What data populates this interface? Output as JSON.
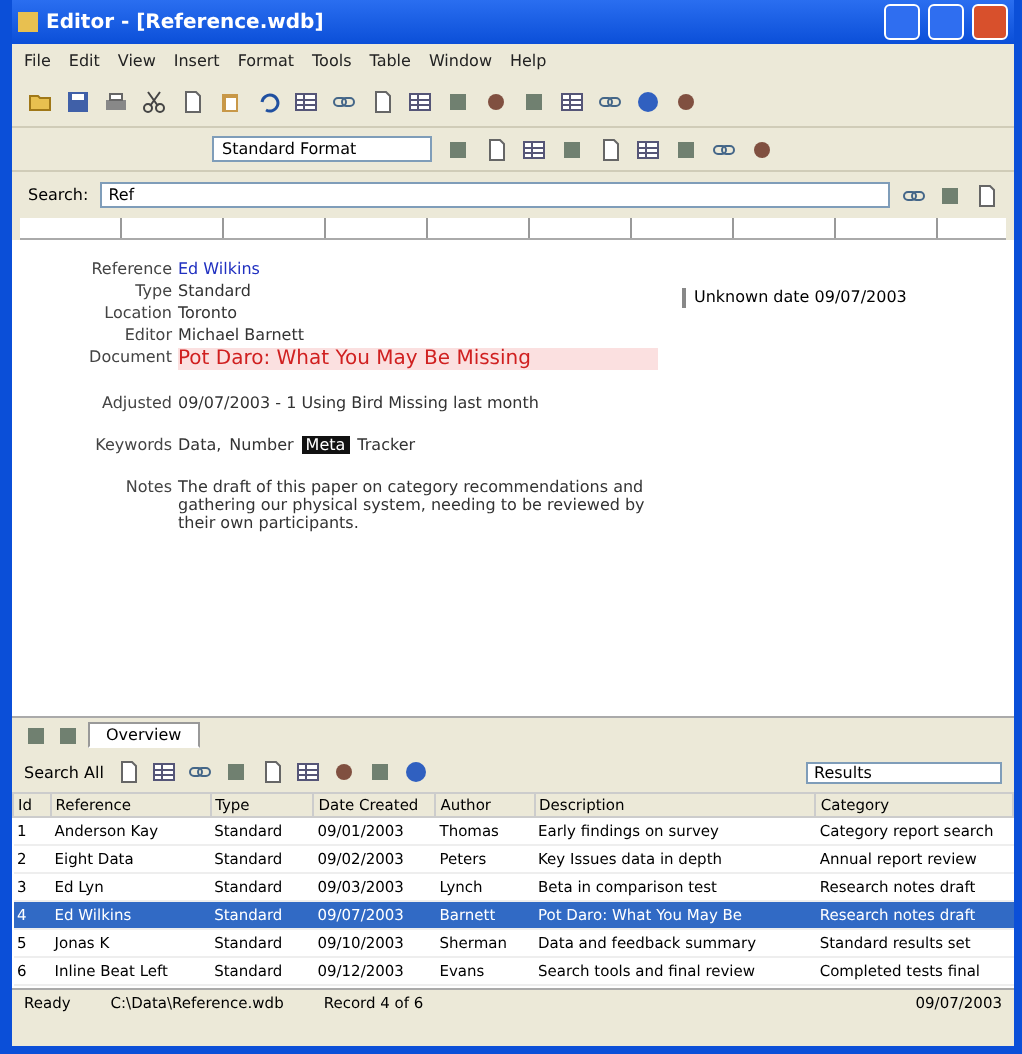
{
  "window": {
    "title": "Editor - [Reference.wdb]"
  },
  "menu": [
    "File",
    "Edit",
    "View",
    "Insert",
    "Format",
    "Tools",
    "Table",
    "Window",
    "Help"
  ],
  "format_bar": {
    "style": "Standard Format"
  },
  "search": {
    "label": "Search:",
    "value": "Ref"
  },
  "form": {
    "fields": [
      {
        "label": "Reference",
        "kind": "link",
        "value": "Ed Wilkins"
      },
      {
        "label": "Type",
        "kind": "text",
        "value": "Standard"
      },
      {
        "label": "Location",
        "kind": "text",
        "value": "Toronto"
      },
      {
        "label": "Editor",
        "kind": "text",
        "value": "Michael Barnett"
      },
      {
        "label": "Document",
        "kind": "title",
        "value": "Pot Daro: What You May Be Missing"
      },
      {
        "label": "Adjusted",
        "kind": "text",
        "value": "09/07/2003 - 1 Using Bird Missing last month"
      },
      {
        "label": "Keywords",
        "kind": "tags",
        "parts": [
          {
            "text": "Data,",
            "highlight": false
          },
          {
            "text": "Number",
            "highlight": false
          },
          {
            "text": "Meta",
            "highlight": true
          },
          {
            "text": "Tracker",
            "highlight": false
          }
        ]
      },
      {
        "label": "Notes",
        "kind": "text",
        "value": "The draft of this paper on category recommendations and gathering our physical system, needing to be reviewed by their own participants."
      }
    ],
    "side_note": "Unknown date 09/07/2003"
  },
  "tabs": [
    {
      "label": "Overview",
      "selected": true
    }
  ],
  "results_bar": {
    "label": "Search All",
    "dropdown": "Results"
  },
  "table": {
    "columns": [
      "Id",
      "Reference",
      "Type",
      "Date Created",
      "Author",
      "Description",
      "Category"
    ],
    "rows": [
      {
        "selected": false,
        "cells": [
          "1",
          "Anderson Kay",
          "Standard",
          "09/01/2003",
          "Thomas",
          "Early findings on survey",
          "Category report search"
        ]
      },
      {
        "selected": false,
        "cells": [
          "2",
          "Eight Data",
          "Standard",
          "09/02/2003",
          "Peters",
          "Key Issues data in depth",
          "Annual report review"
        ]
      },
      {
        "selected": false,
        "cells": [
          "3",
          "Ed Lyn",
          "Standard",
          "09/03/2003",
          "Lynch",
          "Beta in comparison test",
          "Research notes draft"
        ]
      },
      {
        "selected": true,
        "cells": [
          "4",
          "Ed Wilkins",
          "Standard",
          "09/07/2003",
          "Barnett",
          "Pot Daro: What You May Be",
          "Research notes draft"
        ]
      },
      {
        "selected": false,
        "cells": [
          "5",
          "Jonas K",
          "Standard",
          "09/10/2003",
          "Sherman",
          "Data and feedback summary",
          "Standard results set"
        ]
      },
      {
        "selected": false,
        "cells": [
          "6",
          "Inline Beat Left",
          "Standard",
          "09/12/2003",
          "Evans",
          "Search tools and final review",
          "Completed tests final"
        ]
      }
    ]
  },
  "status_bar": [
    "Ready",
    "C:\\Data\\Reference.wdb",
    "Record 4 of 6",
    "09/07/2003"
  ]
}
